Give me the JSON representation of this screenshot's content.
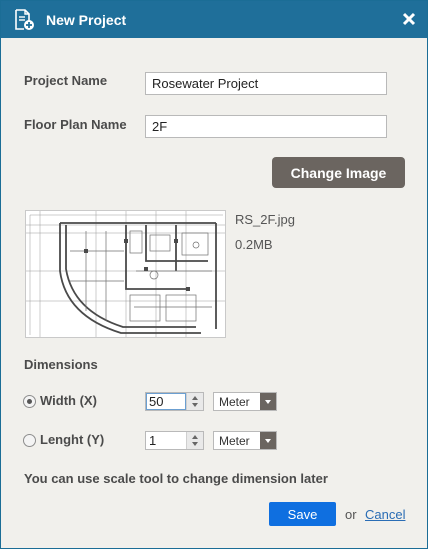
{
  "dialog": {
    "title": "New Project",
    "icons": {
      "title": "new-document-icon",
      "close": "close-icon"
    }
  },
  "form": {
    "project_name": {
      "label": "Project Name",
      "value": "Rosewater Project"
    },
    "floor_plan_name": {
      "label": "Floor Plan Name",
      "value": "2F"
    },
    "change_image_label": "Change Image"
  },
  "image": {
    "file_name": "RS_2F.jpg",
    "file_size": "0.2MB"
  },
  "dimensions": {
    "title": "Dimensions",
    "width": {
      "label": "Width (X)",
      "value": "50",
      "unit": "Meter",
      "selected": true
    },
    "length": {
      "label": "Lenght (Y)",
      "value": "1",
      "unit": "Meter",
      "selected": false
    }
  },
  "hint": "You can use scale tool to change dimension later",
  "footer": {
    "save_label": "Save",
    "or_text": "or",
    "cancel_label": "Cancel"
  },
  "colors": {
    "titlebar": "#1f6f9a",
    "background": "#f1f0ec",
    "primary_button": "#0f6fe0",
    "secondary_button": "#6b6560",
    "link": "#2a6db5"
  }
}
